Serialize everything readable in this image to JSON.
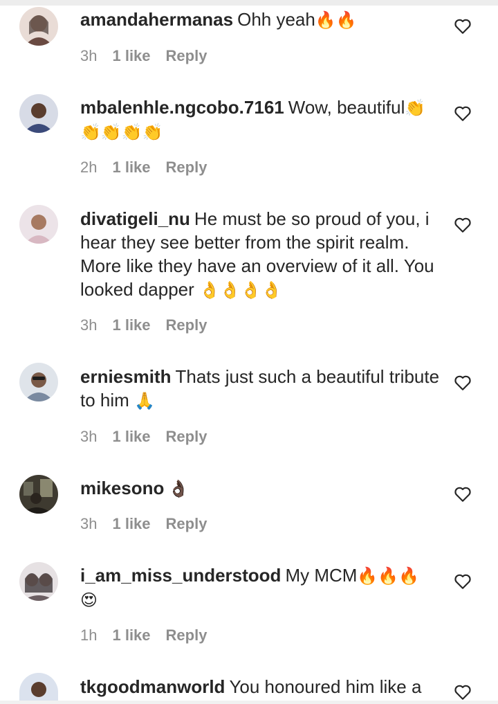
{
  "comments": [
    {
      "username": "amandahermanas",
      "text": "Ohh yeah",
      "emojis": "🔥🔥",
      "time": "3h",
      "likes": "1 like",
      "reply": "Reply",
      "avatar_color": "#c9a89a"
    },
    {
      "username": "mbalenhle.ngcobo.7161",
      "text": "Wow, beautiful",
      "emojis": "👏👏👏👏👏",
      "time": "2h",
      "likes": "1 like",
      "reply": "Reply",
      "avatar_color": "#3b4a7a"
    },
    {
      "username": "divatigeli_nu",
      "text": "He must be so proud of you, i hear they see better from the spirit realm. More like they have an overview of it all. You looked dapper ",
      "emojis": "👌👌👌👌",
      "time": "3h",
      "likes": "1 like",
      "reply": "Reply",
      "avatar_color": "#d8b8c2"
    },
    {
      "username": "erniesmith",
      "text": "Thats just such a beautiful tribute to him ",
      "emojis": "🙏",
      "time": "3h",
      "likes": "1 like",
      "reply": "Reply",
      "avatar_color": "#7a8aa0"
    },
    {
      "username": "mikesono",
      "text": "",
      "emojis": "👌🏿",
      "time": "3h",
      "likes": "1 like",
      "reply": "Reply",
      "avatar_color": "#3e3a30"
    },
    {
      "username": "i_am_miss_understood",
      "text": "My MCM",
      "emojis": "🔥🔥🔥 😍",
      "time": "1h",
      "likes": "1 like",
      "reply": "Reply",
      "avatar_color": "#6b5e62"
    },
    {
      "username": "tkgoodmanworld",
      "text": "You honoured him like a",
      "emojis": "",
      "avatar_color": "#4a5f8a"
    }
  ]
}
